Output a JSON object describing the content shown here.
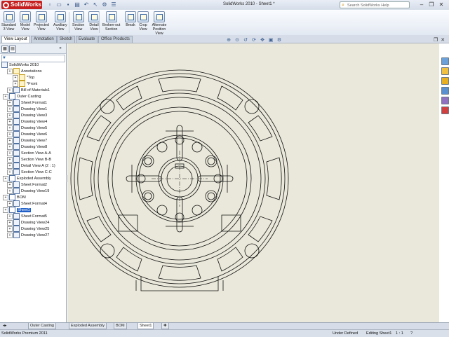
{
  "app": {
    "name": "SolidWorks",
    "window_title": "SolidWorks 2010 - Sheet1 *",
    "help_placeholder": "Search SolidWorks Help"
  },
  "ribbon": {
    "buttons": [
      {
        "line1": "Standard",
        "line2": "3 View"
      },
      {
        "line1": "Model",
        "line2": "View"
      },
      {
        "line1": "Projected",
        "line2": "View"
      },
      {
        "line1": "Auxiliary",
        "line2": "View"
      },
      {
        "line1": "Section",
        "line2": "View"
      },
      {
        "line1": "Detail",
        "line2": "View"
      },
      {
        "line1": "Broken-out",
        "line2": "Section"
      },
      {
        "line1": "Break",
        "line2": ""
      },
      {
        "line1": "Crop",
        "line2": "View"
      },
      {
        "line1": "Alternate",
        "line2": "Position View"
      }
    ]
  },
  "tabs": [
    "View Layout",
    "Annotation",
    "Sketch",
    "Evaluate",
    "Office Products"
  ],
  "tree": {
    "root": "SolidWorks 2010",
    "items": [
      {
        "label": "Annotations",
        "level": 1
      },
      {
        "label": "*Top",
        "level": 2
      },
      {
        "label": "*Front",
        "level": 2
      },
      {
        "label": "Bill of Materials1",
        "level": 1
      },
      {
        "label": "Outer Casting",
        "level": 0
      },
      {
        "label": "Sheet Format1",
        "level": 1
      },
      {
        "label": "Drawing View1",
        "level": 1
      },
      {
        "label": "Drawing View3",
        "level": 1
      },
      {
        "label": "Drawing View4",
        "level": 1
      },
      {
        "label": "Drawing View5",
        "level": 1
      },
      {
        "label": "Drawing View6",
        "level": 1
      },
      {
        "label": "Drawing View7",
        "level": 1
      },
      {
        "label": "Drawing View8",
        "level": 1
      },
      {
        "label": "Section View A-A",
        "level": 1
      },
      {
        "label": "Section View B-B",
        "level": 1
      },
      {
        "label": "Detail View A (2 : 1)",
        "level": 1
      },
      {
        "label": "Section View C-C",
        "level": 1
      },
      {
        "label": "Exploded Assembly",
        "level": 0
      },
      {
        "label": "Sheet Format2",
        "level": 1
      },
      {
        "label": "Drawing View19",
        "level": 1
      },
      {
        "label": "BOM",
        "level": 0
      },
      {
        "label": "Sheet Format4",
        "level": 1
      },
      {
        "label": "Sheet1",
        "level": 0,
        "selected": true
      },
      {
        "label": "Sheet Format5",
        "level": 1
      },
      {
        "label": "Drawing View24",
        "level": 1
      },
      {
        "label": "Drawing View25",
        "level": 1
      },
      {
        "label": "Drawing View27",
        "level": 1
      }
    ]
  },
  "sheet_tabs": [
    "Outer Casting",
    "Exploded Assembly",
    "BOM",
    "Sheet1"
  ],
  "status": {
    "product": "SolidWorks Premium 2011",
    "definition": "Under Defined",
    "editing": "Editing Sheet1",
    "scale": "1 : 1"
  },
  "colors": {
    "canvas": "#eae8da",
    "selection": "#1e5fc8",
    "brand": "#c61f1f"
  }
}
